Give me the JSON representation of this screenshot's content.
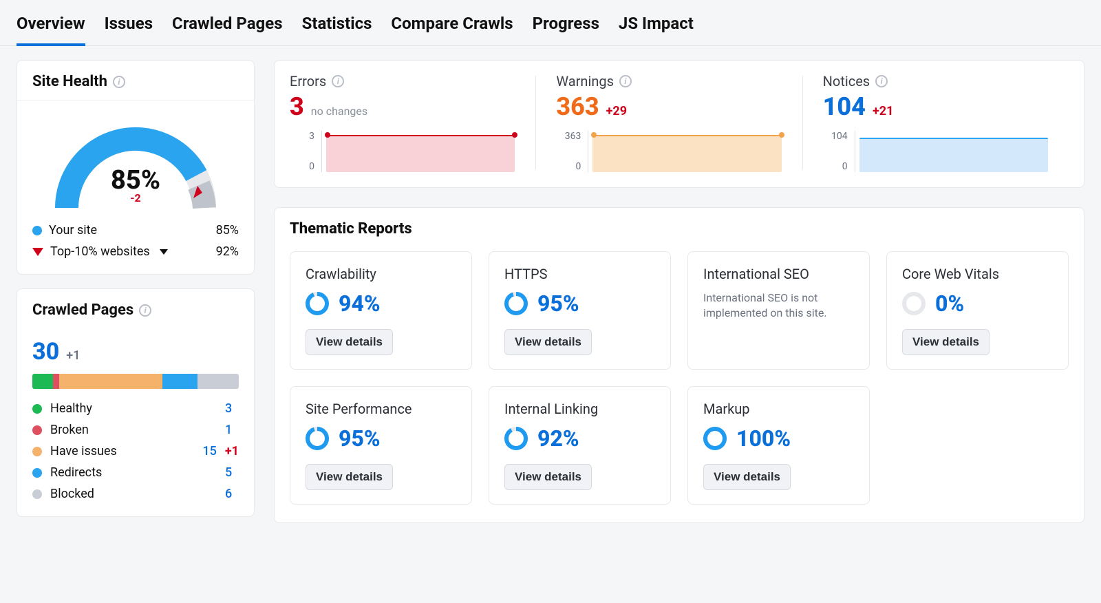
{
  "tabs": [
    "Overview",
    "Issues",
    "Crawled Pages",
    "Statistics",
    "Compare Crawls",
    "Progress",
    "JS Impact"
  ],
  "active_tab": 0,
  "site_health": {
    "title": "Site Health",
    "percent": "85%",
    "delta": "-2",
    "legend": {
      "your_site_label": "Your site",
      "your_site_value": "85%",
      "top10_label": "Top-10% websites",
      "top10_value": "92%"
    }
  },
  "crawled_pages": {
    "title": "Crawled Pages",
    "total": "30",
    "total_delta": "+1",
    "breakdown": [
      {
        "key": "healthy",
        "label": "Healthy",
        "value": "3",
        "delta": "",
        "color": "#1db954",
        "width": 10
      },
      {
        "key": "broken",
        "label": "Broken",
        "value": "1",
        "delta": "",
        "color": "#e04f5f",
        "width": 3
      },
      {
        "key": "issues",
        "label": "Have issues",
        "value": "15",
        "delta": "+1",
        "color": "#f5b26b",
        "width": 50
      },
      {
        "key": "redirects",
        "label": "Redirects",
        "value": "5",
        "delta": "",
        "color": "#2aa4ee",
        "width": 17
      },
      {
        "key": "blocked",
        "label": "Blocked",
        "value": "6",
        "delta": "",
        "color": "#c9ced6",
        "width": 20
      }
    ]
  },
  "summary": {
    "errors": {
      "label": "Errors",
      "value": "3",
      "sub": "no changes",
      "axis_top": "3",
      "axis_bottom": "0"
    },
    "warnings": {
      "label": "Warnings",
      "value": "363",
      "delta": "+29",
      "axis_top": "363",
      "axis_bottom": "0"
    },
    "notices": {
      "label": "Notices",
      "value": "104",
      "delta": "+21",
      "axis_top": "104",
      "axis_bottom": "0"
    }
  },
  "thematic": {
    "title": "Thematic Reports",
    "view_details": "View details",
    "reports": [
      {
        "key": "crawlability",
        "title": "Crawlability",
        "percent": "94%",
        "pct_num": 94,
        "has_btn": true
      },
      {
        "key": "https",
        "title": "HTTPS",
        "percent": "95%",
        "pct_num": 95,
        "has_btn": true
      },
      {
        "key": "international",
        "title": "International SEO",
        "note": "International SEO is not implemented on this site.",
        "has_btn": false
      },
      {
        "key": "cwv",
        "title": "Core Web Vitals",
        "percent": "0%",
        "pct_num": 0,
        "has_btn": true
      },
      {
        "key": "performance",
        "title": "Site Performance",
        "percent": "95%",
        "pct_num": 95,
        "has_btn": true
      },
      {
        "key": "internal",
        "title": "Internal Linking",
        "percent": "92%",
        "pct_num": 92,
        "has_btn": true
      },
      {
        "key": "markup",
        "title": "Markup",
        "percent": "100%",
        "pct_num": 100,
        "has_btn": true
      }
    ]
  },
  "chart_data": [
    {
      "type": "line",
      "title": "Site Health",
      "value": 85,
      "delta": -2,
      "series": [
        {
          "name": "Your site",
          "values": [
            85
          ]
        },
        {
          "name": "Top-10% websites",
          "values": [
            92
          ]
        }
      ],
      "ylim": [
        0,
        100
      ]
    },
    {
      "type": "bar",
      "title": "Crawled Pages",
      "categories": [
        "Healthy",
        "Broken",
        "Have issues",
        "Redirects",
        "Blocked"
      ],
      "values": [
        3,
        1,
        15,
        5,
        6
      ],
      "total": 30
    },
    {
      "type": "area",
      "title": "Errors",
      "x": [
        0,
        1
      ],
      "values": [
        3,
        3
      ],
      "ylim": [
        0,
        3
      ]
    },
    {
      "type": "area",
      "title": "Warnings",
      "x": [
        0,
        1
      ],
      "values": [
        363,
        363
      ],
      "ylim": [
        0,
        363
      ]
    },
    {
      "type": "area",
      "title": "Notices",
      "x": [
        0,
        1
      ],
      "values": [
        104,
        104
      ],
      "ylim": [
        0,
        104
      ]
    }
  ]
}
